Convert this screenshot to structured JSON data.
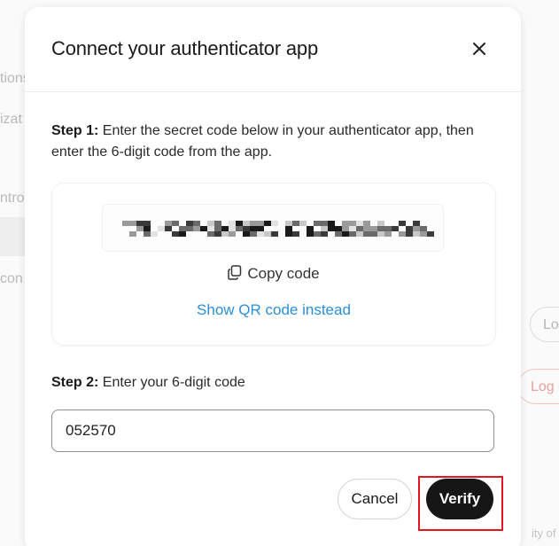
{
  "background": {
    "fragments": [
      "tions",
      "izat",
      "ntro",
      "con",
      "ity of"
    ],
    "logout_buttons": [
      "Lo",
      "Log o"
    ]
  },
  "modal": {
    "title": "Connect your authenticator app",
    "close_icon": "close-icon",
    "step1": {
      "label": "Step 1:",
      "text": " Enter the secret code below in your authenticator app, then enter the 6-digit code from the app."
    },
    "secret_code": {
      "copy_icon": "copy-icon",
      "copy_label": "Copy code",
      "qr_link": "Show QR code instead"
    },
    "step2": {
      "label": "Step 2:",
      "text": " Enter your 6-digit code"
    },
    "code_input": {
      "value": "052570"
    },
    "buttons": {
      "cancel": "Cancel",
      "verify": "Verify"
    }
  },
  "colors": {
    "link": "#2b8fd6",
    "primary_button": "#161616",
    "highlight_border": "#e3161c"
  }
}
